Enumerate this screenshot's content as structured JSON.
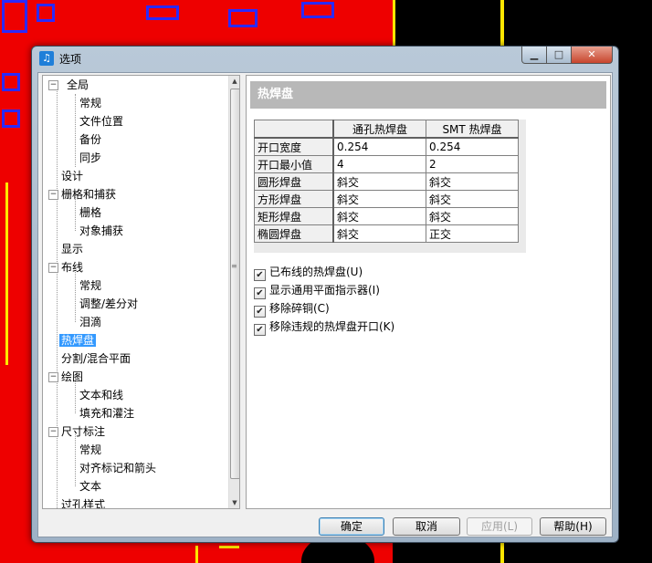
{
  "window": {
    "title": "选项",
    "icon": "app-icon",
    "min_glyph": "▁",
    "max_glyph": "□",
    "close_glyph": "✕"
  },
  "tree": {
    "items": [
      {
        "label": "全局",
        "toggle": "−"
      },
      {
        "label": "常规"
      },
      {
        "label": "文件位置"
      },
      {
        "label": "备份"
      },
      {
        "label": "同步"
      },
      {
        "label": "设计"
      },
      {
        "label": "栅格和捕获",
        "toggle": "−"
      },
      {
        "label": "栅格"
      },
      {
        "label": "对象捕获"
      },
      {
        "label": "显示"
      },
      {
        "label": "布线",
        "toggle": "−"
      },
      {
        "label": "常规"
      },
      {
        "label": "调整/差分对"
      },
      {
        "label": "泪滴"
      },
      {
        "label": "热焊盘",
        "selected": true
      },
      {
        "label": "分割/混合平面"
      },
      {
        "label": "绘图",
        "toggle": "−"
      },
      {
        "label": "文本和线"
      },
      {
        "label": "填充和灌注"
      },
      {
        "label": "尺寸标注",
        "toggle": "−"
      },
      {
        "label": "常规"
      },
      {
        "label": "对齐标记和箭头"
      },
      {
        "label": "文本"
      },
      {
        "label": "过孔样式"
      }
    ]
  },
  "panel": {
    "header": "热焊盘",
    "grid": {
      "columns": [
        "通孔热焊盘",
        "SMT 热焊盘"
      ],
      "rows": [
        {
          "label": "开口宽度",
          "values": [
            "0.254",
            "0.254"
          ]
        },
        {
          "label": "开口最小值",
          "values": [
            "4",
            "2"
          ]
        },
        {
          "label": "圆形焊盘",
          "values": [
            "斜交",
            "斜交"
          ]
        },
        {
          "label": "方形焊盘",
          "values": [
            "斜交",
            "斜交"
          ]
        },
        {
          "label": "矩形焊盘",
          "values": [
            "斜交",
            "斜交"
          ]
        },
        {
          "label": "椭圆焊盘",
          "values": [
            "斜交",
            "正交"
          ]
        }
      ]
    },
    "checkboxes": [
      {
        "label": "已布线的热焊盘(U)",
        "checked": true
      },
      {
        "label": "显示通用平面指示器(I)",
        "checked": true
      },
      {
        "label": "移除碎铜(C)",
        "checked": true
      },
      {
        "label": "移除违规的热焊盘开口(K)",
        "checked": true
      }
    ]
  },
  "buttons": {
    "ok": "确定",
    "cancel": "取消",
    "apply": "应用(L)",
    "help": "帮助(H)"
  }
}
